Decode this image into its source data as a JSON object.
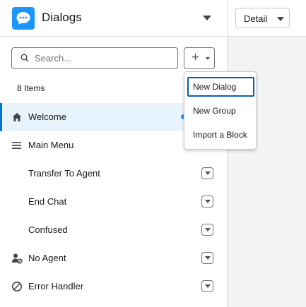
{
  "header": {
    "title": "Dialogs",
    "view_select": "Detail"
  },
  "search": {
    "placeholder": "Search..."
  },
  "list": {
    "count_label": "8 Items",
    "items": [
      {
        "label": "Welcome",
        "icon": "home-icon",
        "selected": true
      },
      {
        "label": "Main Menu",
        "icon": "menu-icon"
      },
      {
        "label": "Transfer To Agent",
        "icon": ""
      },
      {
        "label": "End Chat",
        "icon": ""
      },
      {
        "label": "Confused",
        "icon": ""
      },
      {
        "label": "No Agent",
        "icon": "no-agent-icon"
      },
      {
        "label": "Error Handler",
        "icon": "ban-icon"
      }
    ]
  },
  "add_menu": {
    "items": [
      {
        "label": "New Dialog",
        "focused": true
      },
      {
        "label": "New Group"
      },
      {
        "label": "Import a Block"
      }
    ]
  },
  "colors": {
    "accent": "#1b96ff",
    "brand": "#0176d3",
    "selected_bg": "#e8f4fd"
  }
}
